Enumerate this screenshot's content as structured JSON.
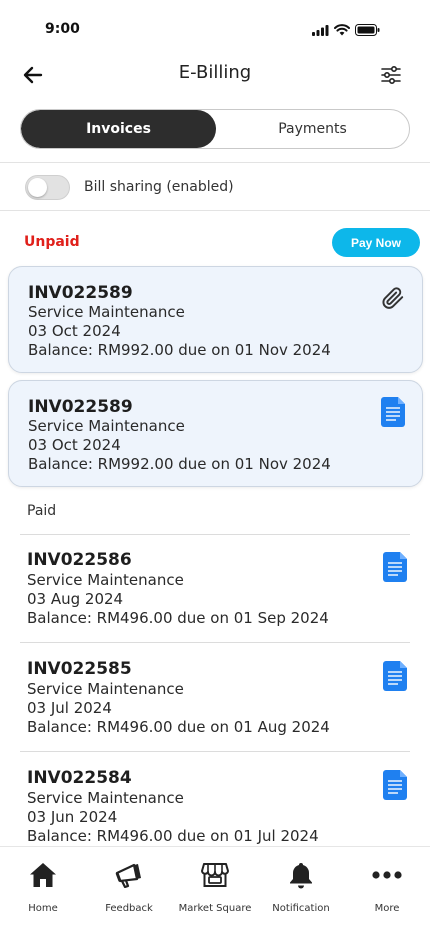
{
  "status_bar": {
    "time": "9:00"
  },
  "header": {
    "title": "E-Billing",
    "back_icon": "arrow-left-icon",
    "filter_icon": "sliders-icon"
  },
  "tabs": [
    {
      "label": "Invoices",
      "active": true
    },
    {
      "label": "Payments",
      "active": false
    }
  ],
  "bill_sharing": {
    "label": "Bill sharing (enabled)",
    "on": false
  },
  "unpaid": {
    "title": "Unpaid",
    "pay_now": "Pay Now",
    "invoices": [
      {
        "number": "INV022589",
        "service": "Service Maintenance",
        "date": "03 Oct 2024",
        "balance": "Balance: RM992.00 due on 01 Nov 2024",
        "icon": "paperclip-icon"
      },
      {
        "number": "INV022589",
        "service": "Service Maintenance",
        "date": "03 Oct 2024",
        "balance": "Balance: RM992.00 due on 01 Nov 2024",
        "icon": "document-icon"
      }
    ]
  },
  "paid": {
    "title": "Paid",
    "invoices": [
      {
        "number": "INV022586",
        "service": "Service Maintenance",
        "date": "03 Aug 2024",
        "balance": "Balance: RM496.00 due on 01 Sep 2024",
        "icon": "document-icon"
      },
      {
        "number": "INV022585",
        "service": "Service Maintenance",
        "date": "03 Jul 2024",
        "balance": "Balance: RM496.00 due on 01 Aug 2024",
        "icon": "document-icon"
      },
      {
        "number": "INV022584",
        "service": "Service Maintenance",
        "date": "03 Jun 2024",
        "balance": "Balance: RM496.00 due on 01 Jul 2024",
        "icon": "document-icon"
      }
    ]
  },
  "bottom_nav": [
    {
      "label": "Home",
      "icon": "home-icon"
    },
    {
      "label": "Feedback",
      "icon": "megaphone-icon"
    },
    {
      "label": "Market Square",
      "icon": "store-icon"
    },
    {
      "label": "Notification",
      "icon": "bell-icon"
    },
    {
      "label": "More",
      "icon": "more-icon"
    }
  ],
  "colors": {
    "accent": "#0db7ea",
    "unpaid": "#e0201b",
    "doc_icon": "#1f80f0",
    "card_bg": "#eef4fc",
    "active_tab": "#2d2d2d"
  }
}
